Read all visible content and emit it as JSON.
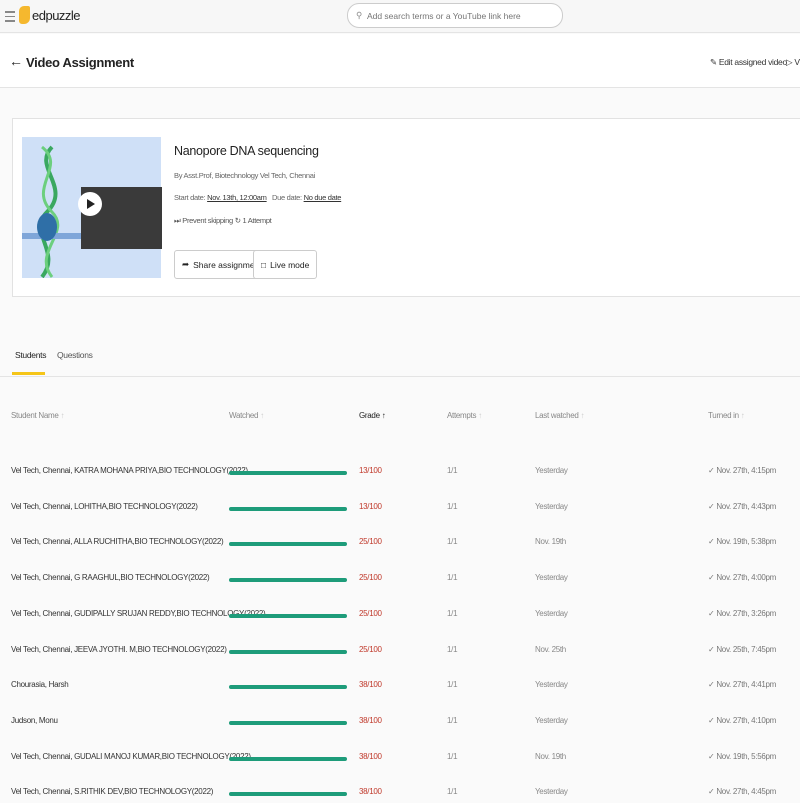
{
  "topbar": {
    "logo": "edpuzzle",
    "search_placeholder": "Add search terms or a YouTube link here"
  },
  "header": {
    "title": "Video Assignment",
    "edit_label": "Edit assigned video",
    "view_label": "V"
  },
  "assignment": {
    "video_title": "Nanopore DNA sequencing",
    "author": "By Asst.Prof, Biotechnology Vel Tech, Chennai",
    "start_label": "Start date:",
    "start_date": "Nov. 13th, 12:00am",
    "due_label": "Due date:",
    "due_date": "No due date",
    "prevent_skipping": "Prevent skipping",
    "attempts": "1 Attempt",
    "share_label": "Share assignment",
    "live_label": "Live mode"
  },
  "tabs": [
    {
      "label": "Students",
      "active": true
    },
    {
      "label": "Questions",
      "active": false
    }
  ],
  "colors": {
    "accent": "#f5c518",
    "progress": "#1e9c7a",
    "grade": "#c0392b"
  },
  "table": {
    "columns": [
      "Student Name",
      "Watched",
      "Grade",
      "Attempts",
      "Last watched",
      "Turned in"
    ],
    "sorted_column": "Grade",
    "rows": [
      {
        "name": "Vel Tech, Chennai, KATRA MOHANA PRIYA,BIO TECHNOLOGY(2022)",
        "watched": 100,
        "grade": "13/100",
        "attempts": "1/1",
        "last_watched": "Yesterday",
        "turned_in": "✓ Nov. 27th, 4:15pm"
      },
      {
        "name": "Vel Tech, Chennai, LOHITHA,BIO TECHNOLOGY(2022)",
        "watched": 100,
        "grade": "13/100",
        "attempts": "1/1",
        "last_watched": "Yesterday",
        "turned_in": "✓ Nov. 27th, 4:43pm"
      },
      {
        "name": "Vel Tech, Chennai, ALLA RUCHITHA,BIO TECHNOLOGY(2022)",
        "watched": 100,
        "grade": "25/100",
        "attempts": "1/1",
        "last_watched": "Nov. 19th",
        "turned_in": "✓ Nov. 19th, 5:38pm"
      },
      {
        "name": "Vel Tech, Chennai, G RAAGHUL,BIO TECHNOLOGY(2022)",
        "watched": 100,
        "grade": "25/100",
        "attempts": "1/1",
        "last_watched": "Yesterday",
        "turned_in": "✓ Nov. 27th, 4:00pm"
      },
      {
        "name": "Vel Tech, Chennai, GUDIPALLY SRUJAN REDDY,BIO TECHNOLOGY(2022)",
        "watched": 100,
        "grade": "25/100",
        "attempts": "1/1",
        "last_watched": "Yesterday",
        "turned_in": "✓ Nov. 27th, 3:26pm"
      },
      {
        "name": "Vel Tech, Chennai, JEEVA JYOTHI. M,BIO TECHNOLOGY(2022)",
        "watched": 100,
        "grade": "25/100",
        "attempts": "1/1",
        "last_watched": "Nov. 25th",
        "turned_in": "✓ Nov. 25th, 7:45pm"
      },
      {
        "name": "Chourasia, Harsh",
        "watched": 100,
        "grade": "38/100",
        "attempts": "1/1",
        "last_watched": "Yesterday",
        "turned_in": "✓ Nov. 27th, 4:41pm"
      },
      {
        "name": "Judson, Monu",
        "watched": 100,
        "grade": "38/100",
        "attempts": "1/1",
        "last_watched": "Yesterday",
        "turned_in": "✓ Nov. 27th, 4:10pm"
      },
      {
        "name": "Vel Tech, Chennai, GUDALI MANOJ KUMAR,BIO TECHNOLOGY(2022)",
        "watched": 100,
        "grade": "38/100",
        "attempts": "1/1",
        "last_watched": "Nov. 19th",
        "turned_in": "✓ Nov. 19th, 5:56pm"
      },
      {
        "name": "Vel Tech, Chennai, S.RITHIK DEV,BIO TECHNOLOGY(2022)",
        "watched": 100,
        "grade": "38/100",
        "attempts": "1/1",
        "last_watched": "Yesterday",
        "turned_in": "✓ Nov. 27th, 4:45pm"
      }
    ]
  }
}
